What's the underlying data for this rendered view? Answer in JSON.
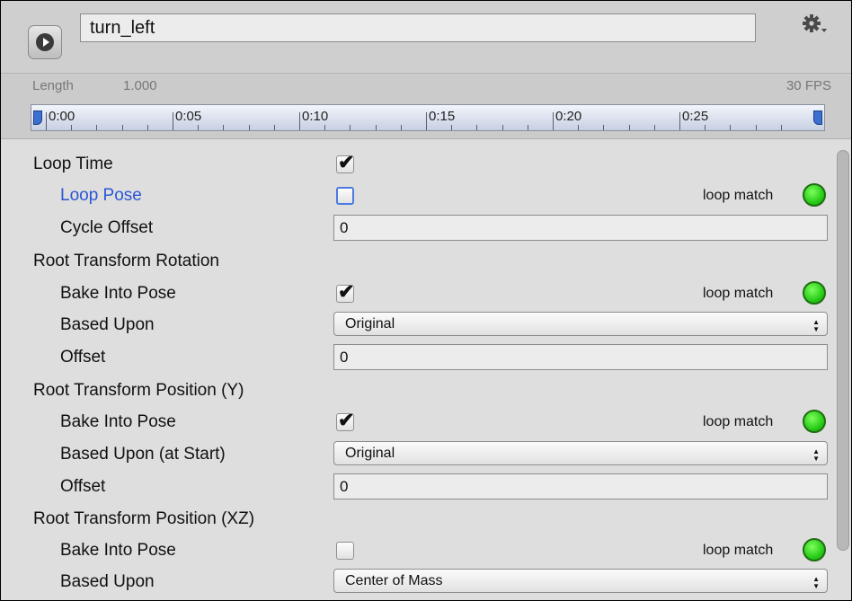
{
  "clip": {
    "name": "turn_left",
    "play_icon": "play-icon",
    "settings_icon": "gear-icon"
  },
  "timeline": {
    "length_label": "Length",
    "length_value": "1.000",
    "fps": "30 FPS",
    "ticks": [
      "0:00",
      "0:05",
      "0:10",
      "0:15",
      "0:20",
      "0:25"
    ]
  },
  "properties": {
    "loop_time": {
      "label": "Loop Time",
      "checked": true
    },
    "loop_pose": {
      "label": "Loop Pose",
      "checked": false,
      "status": "loop match",
      "status_color": "#22c714"
    },
    "cycle_offset": {
      "label": "Cycle Offset",
      "value": "0"
    },
    "root_rotation": {
      "header": "Root Transform Rotation",
      "bake": {
        "label": "Bake Into Pose",
        "checked": true,
        "status": "loop match"
      },
      "based_upon": {
        "label": "Based Upon",
        "value": "Original"
      },
      "offset": {
        "label": "Offset",
        "value": "0"
      }
    },
    "root_position_y": {
      "header": "Root Transform Position (Y)",
      "bake": {
        "label": "Bake Into Pose",
        "checked": true,
        "status": "loop match"
      },
      "based_upon": {
        "label": "Based Upon (at Start)",
        "value": "Original"
      },
      "offset": {
        "label": "Offset",
        "value": "0"
      }
    },
    "root_position_xz": {
      "header": "Root Transform Position (XZ)",
      "bake": {
        "label": "Bake Into Pose",
        "checked": false,
        "status": "loop match"
      },
      "based_upon": {
        "label": "Based Upon",
        "value": "Center of Mass"
      }
    }
  },
  "colors": {
    "loop_pose_label": "#2a56d4",
    "status_green": "#22c714"
  }
}
